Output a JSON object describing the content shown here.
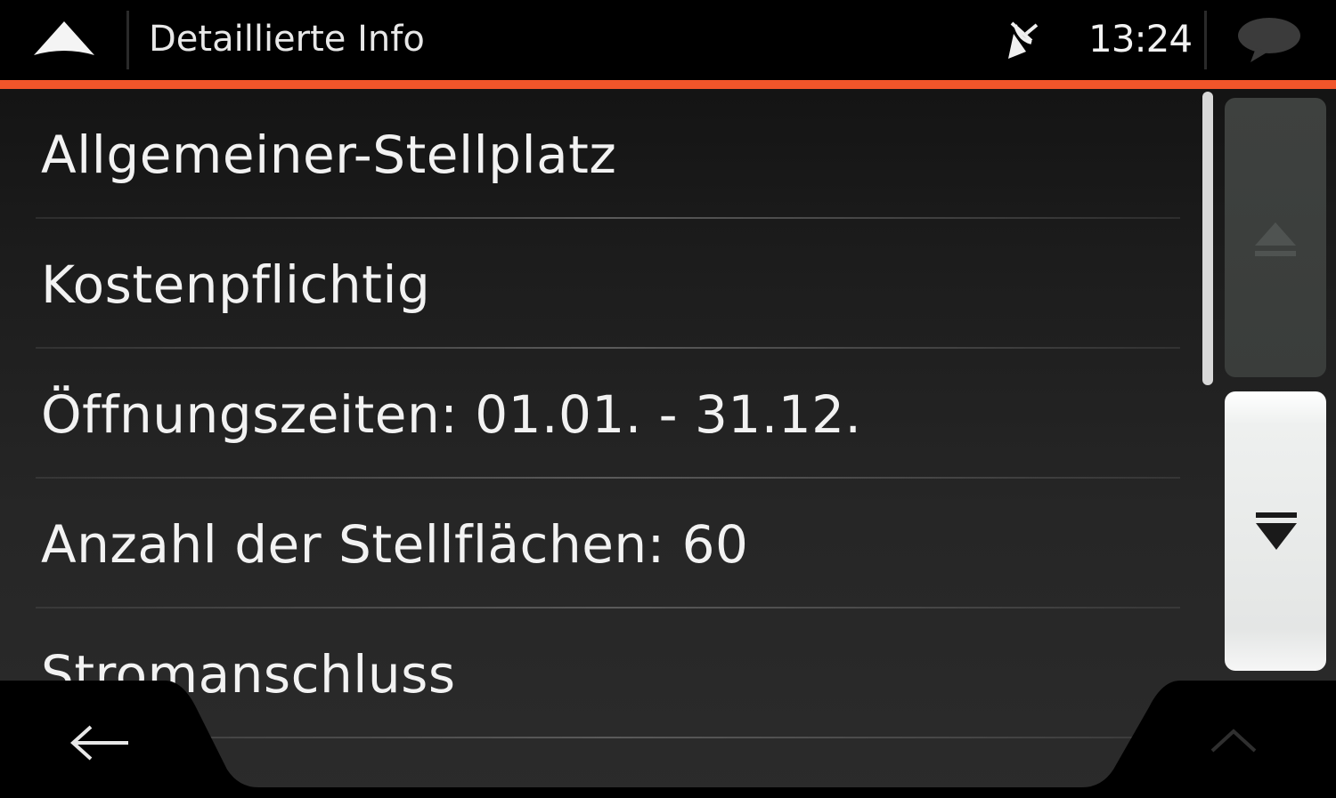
{
  "header": {
    "title": "Detaillierte Info",
    "clock": "13:24",
    "accent_color": "#f0552a",
    "icons": {
      "nav": "navigation-arrow-icon",
      "gps": "gps-signal-lost-icon",
      "messages": "message-bubble-icon"
    }
  },
  "details": {
    "items": [
      {
        "label": "Allgemeiner-Stellplatz"
      },
      {
        "label": "Kostenpflichtig"
      },
      {
        "label": "Öffnungszeiten: 01.01. - 31.12."
      },
      {
        "label": "Anzahl der Stellflächen: 60"
      },
      {
        "label": "Stromanschluss"
      }
    ]
  },
  "scroll": {
    "up_icon": "scroll-up-icon",
    "down_icon": "scroll-down-icon"
  },
  "footer": {
    "back_icon": "back-arrow-icon",
    "up_icon": "chevron-up-icon"
  }
}
